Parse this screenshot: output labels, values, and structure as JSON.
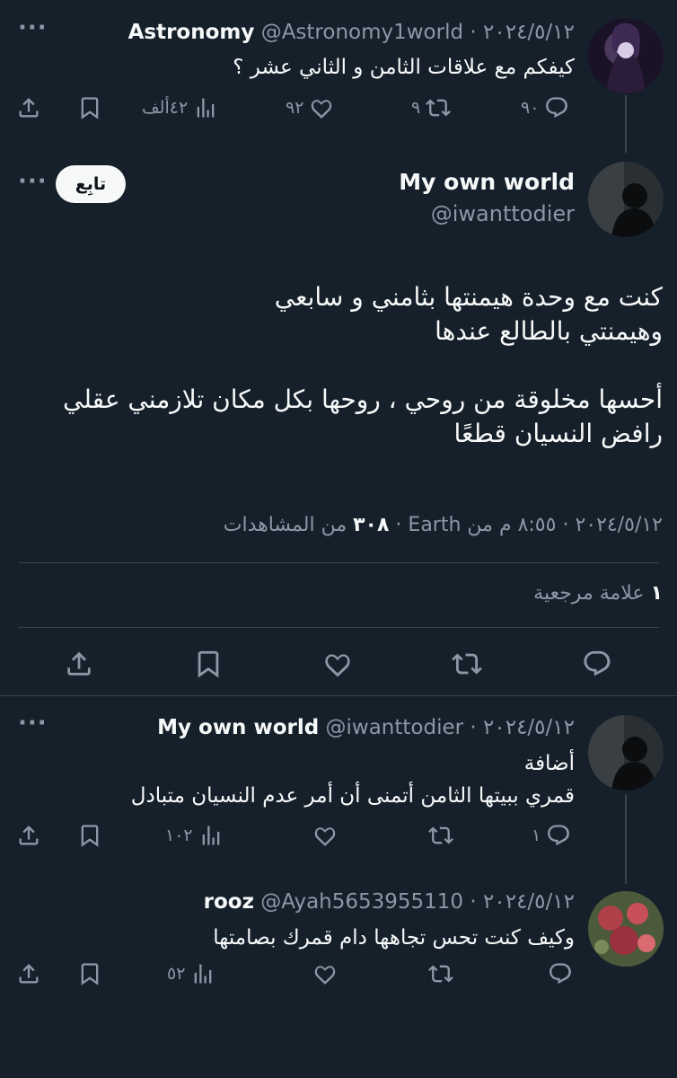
{
  "tweets": [
    {
      "name": "Astronomy",
      "handle": "@Astronomy1world",
      "date": "٢٠٢٤/٥/١٢",
      "text": "كيفكم مع علاقات الثامن و الثاني عشر ؟",
      "replies": "٩٠",
      "retweets": "٩",
      "likes": "٩٢",
      "views": "٤٢ألف"
    }
  ],
  "main_tweet": {
    "name": "My own world",
    "handle": "@iwanttodier",
    "follow_label": "تابِع",
    "lines": [
      "كنت مع وحدة هيمنتها بثامني و سابعي",
      "وهيمنتي بالطالع عندها",
      "أحسها مخلوقة من روحي ، روحها بكل مكان تلازمني عقلي",
      "رافض النسيان قطعًا"
    ],
    "meta_time": "٨:٥٥ م",
    "meta_date": "٢٠٢٤/٥/١٢",
    "meta_from": "من Earth",
    "meta_views_count": "٣٠٨",
    "meta_views_label": "من المشاهدات",
    "bookmarks_count": "١",
    "bookmarks_label": "علامة مرجعية"
  },
  "replies": [
    {
      "name": "My own world",
      "handle": "@iwanttodier",
      "date": "٢٠٢٤/٥/١٢",
      "line1": "أضافة",
      "line2": "قمري ببيتها الثامن أتمنى أن أمر عدم النسيان متبادل",
      "replies": "١",
      "views": "١٠٢"
    },
    {
      "name": "rooz",
      "handle": "@Ayah5653955110",
      "date": "٢٠٢٤/٥/١٢",
      "line1": "وكيف كنت تحس تجاهها دام قمرك بصامتها",
      "views": "٥٢"
    }
  ],
  "icons": [
    "reply-icon",
    "retweet-icon",
    "like-icon",
    "views-icon",
    "bookmark-icon",
    "share-icon",
    "more-icon"
  ],
  "colors": {
    "background": "#15202b",
    "text": "#f7f9f9",
    "muted": "#8b98a5",
    "divider": "#38444d"
  }
}
